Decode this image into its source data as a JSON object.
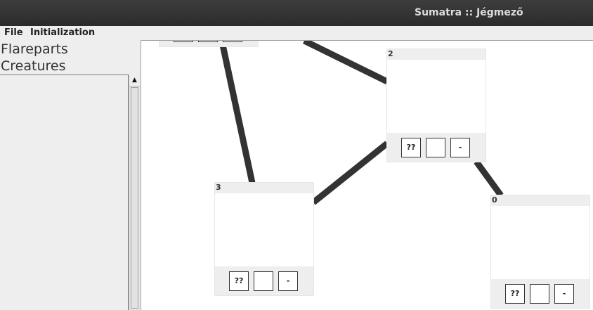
{
  "window": {
    "title": "Sumatra :: Jégmező"
  },
  "menu": {
    "items": [
      "File",
      "Initialization"
    ]
  },
  "sidebar": {
    "sections": [
      "Flareparts",
      "Creatures"
    ],
    "scroll_up_icon": "▲"
  },
  "map": {
    "nodes": [
      {
        "id": "2",
        "buttons": [
          "??",
          "",
          "-"
        ]
      },
      {
        "id": "3",
        "buttons": [
          "??",
          "",
          "-"
        ]
      },
      {
        "id": "0",
        "buttons": [
          "??",
          "",
          "-"
        ]
      }
    ]
  }
}
